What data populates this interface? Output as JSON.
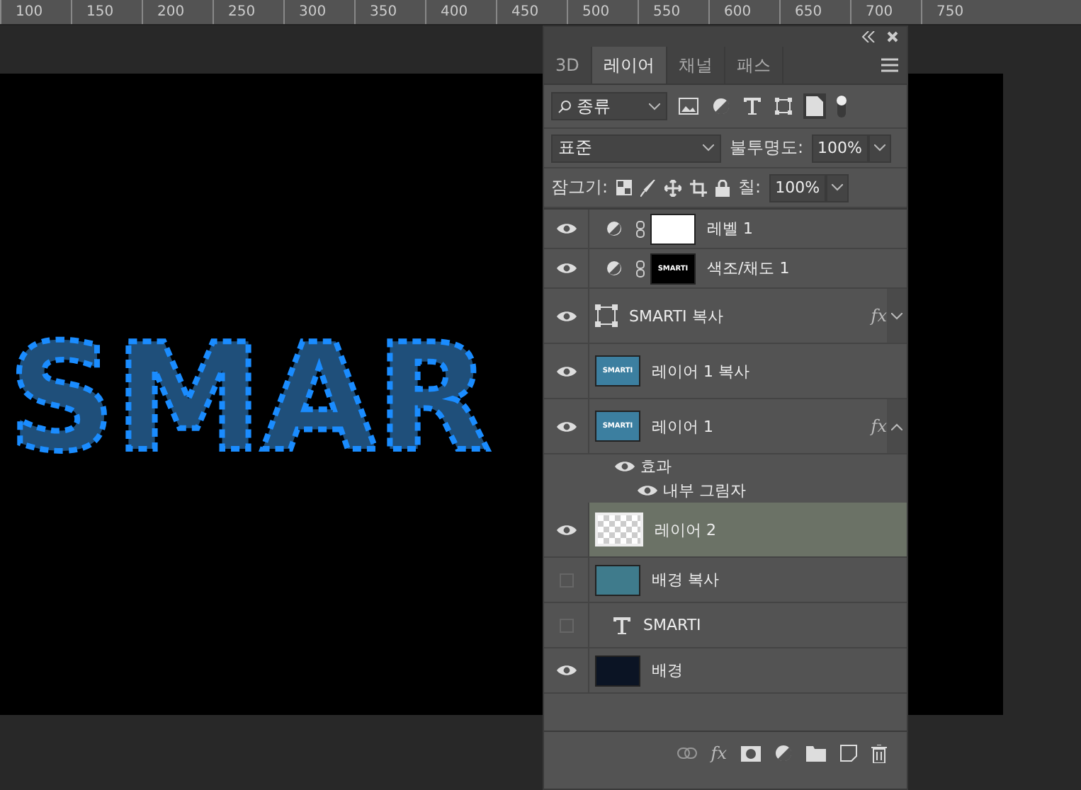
{
  "ruler": {
    "ticks": [
      "100",
      "150",
      "200",
      "250",
      "300",
      "350",
      "400",
      "450",
      "500",
      "550",
      "600",
      "650",
      "700",
      "750"
    ]
  },
  "canvas": {
    "artwork_text": "SMAR"
  },
  "panel": {
    "tabs": [
      {
        "label": "3D",
        "selected": false
      },
      {
        "label": "레이어",
        "selected": true
      },
      {
        "label": "채널",
        "selected": false
      },
      {
        "label": "패스",
        "selected": false
      }
    ],
    "filter": {
      "value": "종류",
      "filter_on": true
    },
    "blend_mode": {
      "value": "표준"
    },
    "opacity": {
      "label": "불투명도:",
      "value": "100%"
    },
    "lock": {
      "label": "잠그기:"
    },
    "fill": {
      "label": "칠:",
      "value": "100%"
    },
    "layers": [
      {
        "name": "레벨 1",
        "kind": "adjustment",
        "color": "#ffffff",
        "visible": true,
        "selected": false
      },
      {
        "name": "색조/채도 1",
        "kind": "adjustment",
        "color": "#000000",
        "thumb_text": "SMARTI",
        "visible": true,
        "selected": false
      },
      {
        "name": "SMARTI 복사",
        "kind": "smart",
        "visible": true,
        "selected": false,
        "fx": "fx",
        "expanded": false
      },
      {
        "name": "레이어 1 복사",
        "kind": "pixel",
        "color": "#3c7fa0",
        "thumb_text": "SMARTI",
        "visible": true,
        "selected": false
      },
      {
        "name": "레이어 1",
        "kind": "pixel",
        "color": "#3c7fa0",
        "thumb_text": "SMARTI",
        "visible": true,
        "selected": false,
        "fx": "fx",
        "expanded": true,
        "effects": [
          {
            "name": "효과",
            "visible": true
          },
          {
            "name": "내부 그림자",
            "visible": true
          }
        ]
      },
      {
        "name": "레이어 2",
        "kind": "transparent",
        "visible": true,
        "selected": true
      },
      {
        "name": "배경 복사",
        "kind": "pixel",
        "color": "#3f7b8c",
        "visible": false,
        "selected": false
      },
      {
        "name": "SMARTI",
        "kind": "text",
        "visible": false,
        "selected": false
      },
      {
        "name": "배경",
        "kind": "pixel",
        "color": "#0b1424",
        "visible": true,
        "selected": false
      }
    ],
    "footer": {
      "fx_label": "fx"
    }
  }
}
